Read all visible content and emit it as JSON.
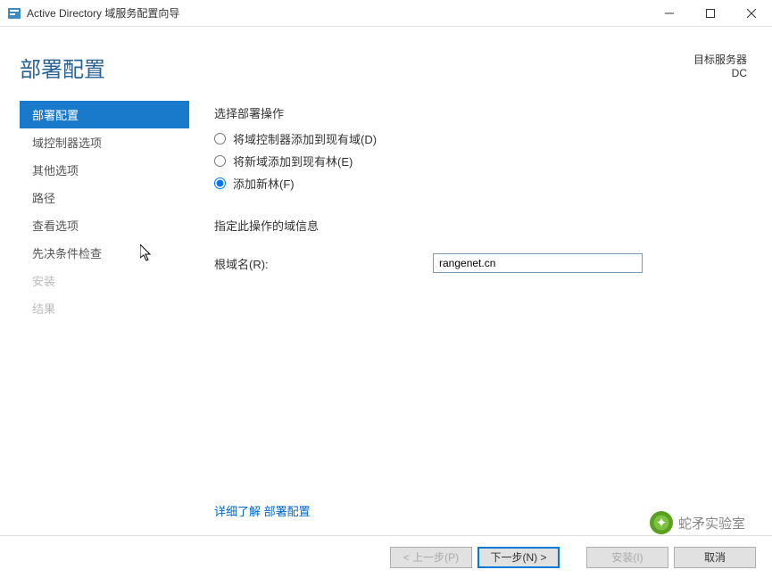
{
  "window": {
    "title": "Active Directory 域服务配置向导"
  },
  "header": {
    "page_title": "部署配置",
    "target_label": "目标服务器",
    "target_value": "DC"
  },
  "sidebar": {
    "items": [
      {
        "label": "部署配置",
        "state": "active"
      },
      {
        "label": "域控制器选项",
        "state": "normal"
      },
      {
        "label": "其他选项",
        "state": "normal"
      },
      {
        "label": "路径",
        "state": "normal"
      },
      {
        "label": "查看选项",
        "state": "normal"
      },
      {
        "label": "先决条件检查",
        "state": "normal"
      },
      {
        "label": "安装",
        "state": "disabled"
      },
      {
        "label": "结果",
        "state": "disabled"
      }
    ]
  },
  "form": {
    "operation_label": "选择部署操作",
    "radios": [
      {
        "label": "将域控制器添加到现有域(D)",
        "checked": false
      },
      {
        "label": "将新域添加到现有林(E)",
        "checked": false
      },
      {
        "label": "添加新林(F)",
        "checked": true
      }
    ],
    "domain_info_label": "指定此操作的域信息",
    "root_domain_label": "根域名(R):",
    "root_domain_value": "rangenet.cn",
    "learn_more": "详细了解 部署配置"
  },
  "footer": {
    "prev": "< 上一步(P)",
    "next": "下一步(N) >",
    "install": "安装(I)",
    "cancel": "取消"
  },
  "watermark": {
    "text": "蛇矛实验室"
  }
}
